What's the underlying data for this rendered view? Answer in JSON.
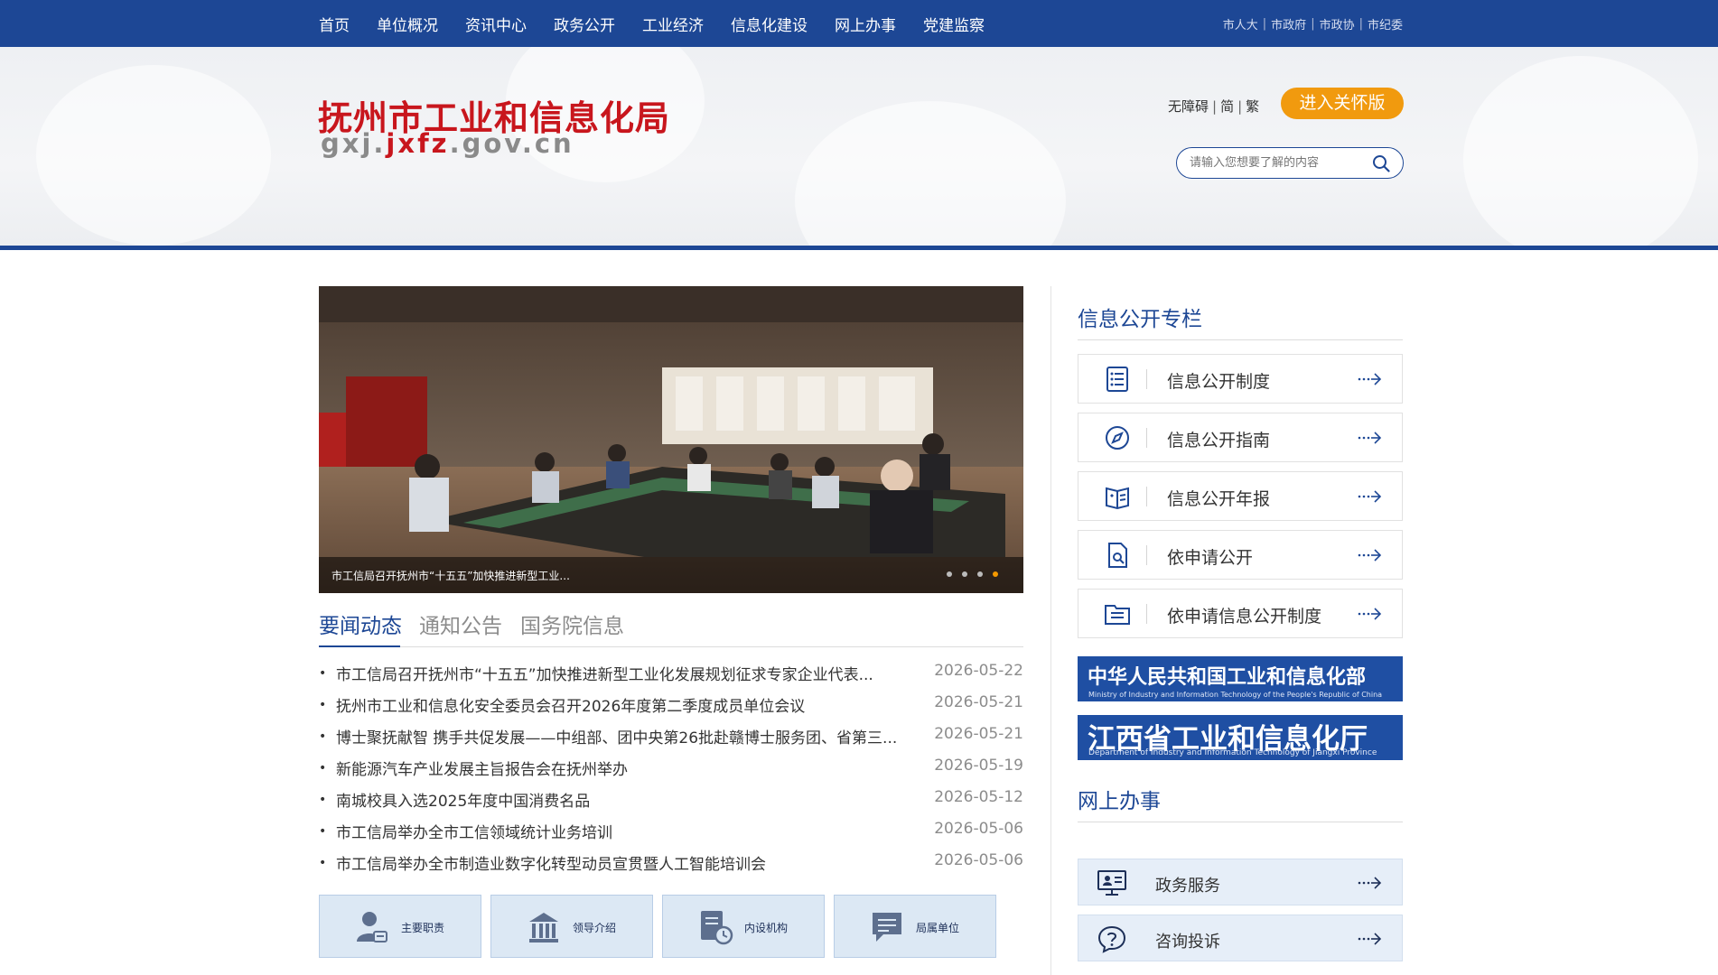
{
  "nav": {
    "items": [
      "首页",
      "单位概况",
      "资讯中心",
      "政务公开",
      "工业经济",
      "信息化建设",
      "网上办事",
      "党建监察"
    ],
    "links": [
      "市人大",
      "市政府",
      "市政协",
      "市纪委"
    ]
  },
  "header": {
    "title": "抚州市工业和信息化局",
    "domain_prefix": "gxj.",
    "domain_red": "jxfz",
    "domain_suffix": ".gov.cn",
    "accessibility": "无障碍",
    "simplified": "简",
    "traditional": "繁",
    "care_button": "进入关怀版",
    "search_placeholder": "请输入您想要了解的内容"
  },
  "carousel": {
    "caption": "市工信局召开抚州市“十五五”加快推进新型工业...",
    "active_dot": 3,
    "dot_count": 4
  },
  "tabs": [
    "要闻动态",
    "通知公告",
    "国务院信息"
  ],
  "news": [
    {
      "title": "市工信局召开抚州市“十五五”加快推进新型工业化发展规划征求专家企业代表...",
      "date": "2026-05-22"
    },
    {
      "title": "抚州市工业和信息化安全委员会召开2026年度第二季度成员单位会议",
      "date": "2026-05-21"
    },
    {
      "title": "博士聚抚献智 携手共促发展——中组部、团中央第26批赴赣博士服务团、省第三...",
      "date": "2026-05-21"
    },
    {
      "title": "新能源汽车产业发展主旨报告会在抚州举办",
      "date": "2026-05-19"
    },
    {
      "title": "南城校具入选2025年度中国消费名品",
      "date": "2026-05-12"
    },
    {
      "title": "市工信局举办全市工信领域统计业务培训",
      "date": "2026-05-06"
    },
    {
      "title": "市工信局举办全市制造业数字化转型动员宣贯暨人工智能培训会",
      "date": "2026-05-06"
    }
  ],
  "quick": [
    {
      "label": "主要职责",
      "icon": "user-icon"
    },
    {
      "label": "领导介绍",
      "icon": "building-icon"
    },
    {
      "label": "内设机构",
      "icon": "document-clock-icon"
    },
    {
      "label": "局属单位",
      "icon": "message-icon"
    }
  ],
  "info_open": {
    "title": "信息公开专栏",
    "items": [
      {
        "label": "信息公开制度",
        "icon": "list-icon"
      },
      {
        "label": "信息公开指南",
        "icon": "compass-icon"
      },
      {
        "label": "信息公开年报",
        "icon": "book-icon"
      },
      {
        "label": "依申请公开",
        "icon": "file-search-icon"
      },
      {
        "label": "依申请信息公开制度",
        "icon": "folder-list-icon"
      }
    ]
  },
  "banners": [
    {
      "main": "中华人民共和国工业和信息化部",
      "sub": "Ministry of Industry and Information Technology of the People's Republic of China"
    },
    {
      "main": "江西省工业和信息化厅",
      "sub": "Department of Industry and Information Technology of Jiangxi Province"
    }
  ],
  "online": {
    "title": "网上办事",
    "items": [
      {
        "label": "政务服务",
        "icon": "monitor-icon"
      },
      {
        "label": "咨询投诉",
        "icon": "question-icon"
      }
    ]
  },
  "colors": {
    "primary": "#1d4795",
    "brand_red": "#c8161d",
    "care_orange": "#f19a0e",
    "active_dot": "#f39800"
  }
}
